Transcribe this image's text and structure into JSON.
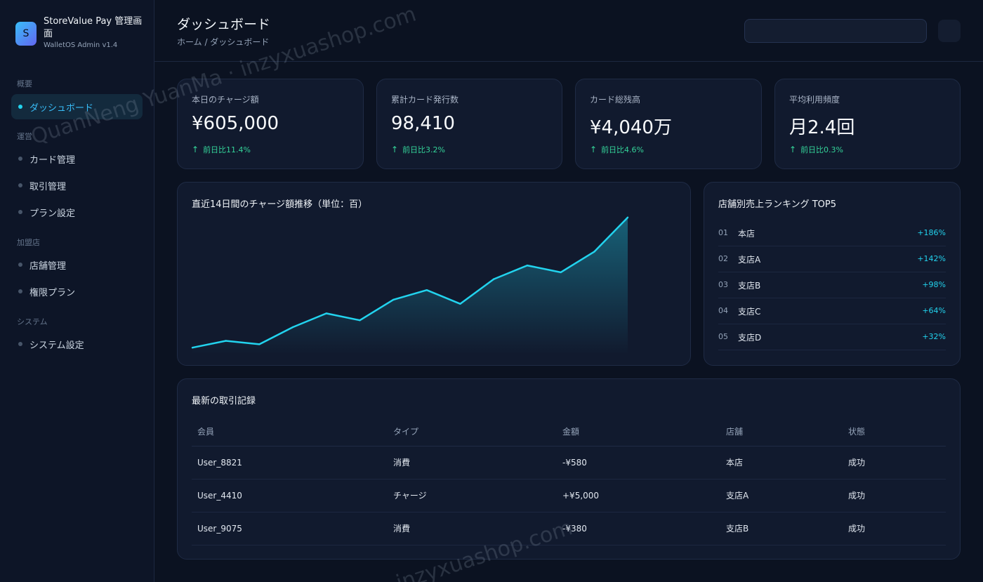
{
  "brand": {
    "logo_letter": "S",
    "title": "StoreValue Pay 管理画面",
    "subtitle": "WalletOS Admin v1.4"
  },
  "sidebar": {
    "sections": [
      {
        "label": "概要",
        "items": [
          {
            "label": "ダッシュボード",
            "active": true
          }
        ]
      },
      {
        "label": "運営",
        "items": [
          {
            "label": "カード管理"
          },
          {
            "label": "取引管理"
          },
          {
            "label": "プラン設定"
          }
        ]
      },
      {
        "label": "加盟店",
        "items": [
          {
            "label": "店舗管理"
          },
          {
            "label": "権限プラン"
          }
        ]
      },
      {
        "label": "システム",
        "items": [
          {
            "label": "システム設定"
          }
        ]
      }
    ]
  },
  "header": {
    "title": "ダッシュボード",
    "breadcrumb": "ホーム / ダッシュボード"
  },
  "stats": [
    {
      "label": "本日のチャージ額",
      "value": "¥605,000",
      "trend": "前日比11.4%"
    },
    {
      "label": "累計カード発行数",
      "value": "98,410",
      "trend": "前日比3.2%"
    },
    {
      "label": "カード総残高",
      "value": "¥4,040万",
      "trend": "前日比4.6%"
    },
    {
      "label": "平均利用頻度",
      "value": "月2.4回",
      "trend": "前日比0.3%"
    }
  ],
  "colors": {
    "accent": "#22d3ee",
    "positive": "#34d399",
    "background": "#0b1221",
    "card": "#111a2e"
  },
  "chart": {
    "title": "直近14日間のチャージ額推移（単位：百）"
  },
  "chart_data": {
    "type": "area",
    "title": "直近14日間のチャージ額推移（単位：百）",
    "x": [
      1,
      2,
      3,
      4,
      5,
      6,
      7,
      8,
      9,
      10,
      11,
      12,
      13,
      14
    ],
    "values": [
      1000,
      1050,
      1025,
      1150,
      1250,
      1200,
      1350,
      1420,
      1320,
      1500,
      1600,
      1550,
      1700,
      1950
    ],
    "ylim": [
      950,
      2000
    ],
    "grid": false,
    "xlabel": "",
    "ylabel": ""
  },
  "ranking": {
    "title": "店舗別売上ランキング TOP5",
    "rows": [
      {
        "rank": "01",
        "name": "本店",
        "pct": "+186%"
      },
      {
        "rank": "02",
        "name": "支店A",
        "pct": "+142%"
      },
      {
        "rank": "03",
        "name": "支店B",
        "pct": "+98%"
      },
      {
        "rank": "04",
        "name": "支店C",
        "pct": "+64%"
      },
      {
        "rank": "05",
        "name": "支店D",
        "pct": "+32%"
      }
    ]
  },
  "transactions": {
    "title": "最新の取引記録",
    "columns": [
      "会員",
      "タイプ",
      "金額",
      "店舗",
      "状態"
    ],
    "rows": [
      [
        "User_8821",
        "消費",
        "-¥580",
        "本店",
        "成功"
      ],
      [
        "User_4410",
        "チャージ",
        "+¥5,000",
        "支店A",
        "成功"
      ],
      [
        "User_9075",
        "消費",
        "-¥380",
        "支店B",
        "成功"
      ]
    ]
  },
  "watermarks": [
    "QuanNeng YuanMa · inzyxuashop.com",
    "inzyxuashop.com"
  ]
}
